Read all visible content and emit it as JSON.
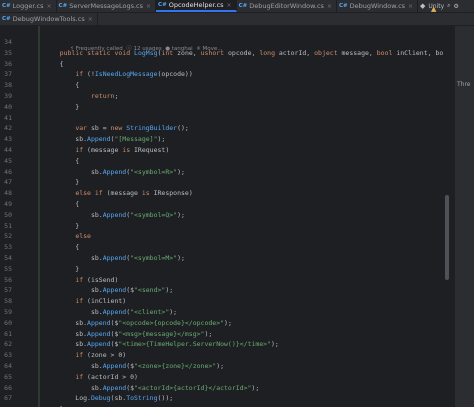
{
  "tabs_row1": [
    {
      "label": "Logger.cs",
      "active": false
    },
    {
      "label": "ServerMessageLogs.cs",
      "active": false
    },
    {
      "label": "OpcodeHelper.cs",
      "active": true
    },
    {
      "label": "DebugEditorWindow.cs",
      "active": false
    },
    {
      "label": "DebugWindow.cs",
      "active": false
    },
    {
      "label": "DebugWindowServerCMD.cs",
      "active": false
    }
  ],
  "tabs_row2": [
    {
      "label": "DebugWindowTools.cs",
      "active": false
    }
  ],
  "top_controls": {
    "unity": "Unity"
  },
  "right_panel": {
    "label": "Thre"
  },
  "gutter": {
    "line_numbers": [
      "34",
      "35",
      "36",
      "37",
      "38",
      "39",
      "40",
      "41",
      "42",
      "43",
      "44",
      "45",
      "46",
      "47",
      "48",
      "49",
      "50",
      "51",
      "52",
      "53",
      "54",
      "55",
      "56",
      "57",
      "58",
      "59",
      "60",
      "61",
      "62",
      "63",
      "64",
      "65",
      "66",
      "67"
    ]
  },
  "inlay_hint": {
    "text": "⚡ Frequently called  ⓘ 12 usages  ● tanghai  ✳ Move..."
  },
  "code_lines": [
    "",
    "    public static void LogMsg(int zone, ushort opcode, long actorId, object message, bool inClient, bo",
    "    {",
    "        if (!IsNeedLogMessage(opcode))",
    "        {",
    "            return;",
    "        }",
    "",
    "        var sb = new StringBuilder();",
    "        sb.Append(\"[Message]\");",
    "        if (message is IRequest)",
    "        {",
    "            sb.Append(\"<symbol=R>\");",
    "        }",
    "        else if (message is IResponse)",
    "        {",
    "            sb.Append(\"<symbol=Q>\");",
    "        }",
    "        else",
    "        {",
    "            sb.Append(\"<symbol=M>\");",
    "        }",
    "        if (isSend)",
    "            sb.Append($\"<send>\");",
    "        if (inClient)",
    "            sb.Append(\"<client>\");",
    "        sb.Append($\"<opcode>{opcode}</opcode>\");",
    "        sb.Append($\"<msg>{message}</msg>\");",
    "        sb.Append($\"<time>{TimeHelper.ServerNow()}</time>\");",
    "        if (zone > 0)",
    "            sb.Append($\"<zone>{zone}</zone>\");",
    "        if (actorId > 0)",
    "            sb.Append($\"<actorId>{actorId}</actorId>\");",
    "        Log.Debug(sb.ToString());",
    "    }"
  ],
  "colors": {
    "bg": "#1e1f22",
    "keyword": "#cf8e6d",
    "string": "#6aab73",
    "method": "#56a8f5",
    "text": "#bcbec4",
    "accent": "#3574f0"
  }
}
